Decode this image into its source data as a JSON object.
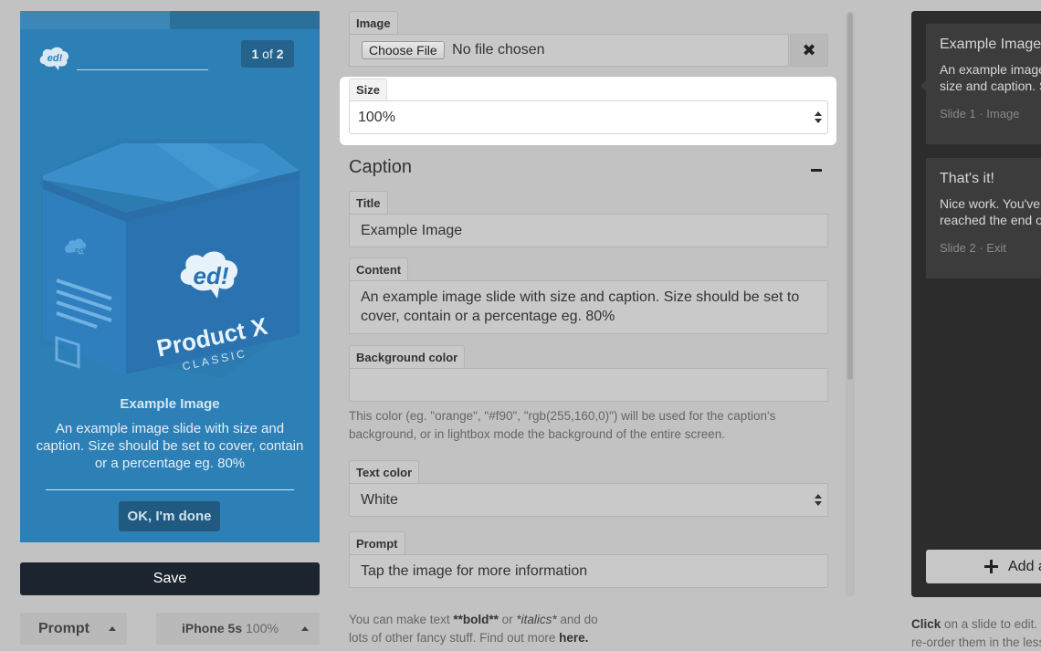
{
  "preview": {
    "progress_fraction": 0.5,
    "slide_current": "1",
    "slide_of": "of",
    "slide_total": "2",
    "logo_text": "ed!",
    "box_logo_text": "ed!",
    "box_product": "Product X",
    "box_edition": "CLASSIC",
    "title": "Example Image",
    "content": "An example image slide with size and caption. Size should be set to cover, contain or a percentage eg. 80%",
    "ok_label": "OK, I'm done"
  },
  "actions": {
    "save_label": "Save",
    "prompt_tab_label": "Prompt",
    "device_label": "iPhone 5s",
    "device_zoom": "100%"
  },
  "form": {
    "image_label": "Image",
    "choose_file_label": "Choose File",
    "file_status": "No file chosen",
    "clear_icon": "✖",
    "size_label": "Size",
    "size_value": "100%",
    "caption_heading": "Caption",
    "title_label": "Title",
    "title_value": "Example Image",
    "content_label": "Content",
    "content_value": "An example image slide with size and caption. Size should be set to cover, contain or a percentage eg. 80%",
    "bg_color_label": "Background color",
    "bg_color_value": "",
    "bg_color_help": "This color (eg. \"orange\", \"#f90\", \"rgb(255,160,0)\") will be used for the caption's background, or in lightbox mode the background of the entire screen.",
    "text_color_label": "Text color",
    "text_color_value": "White",
    "prompt_label": "Prompt",
    "prompt_value": "Tap the image for more information",
    "markdown_help": {
      "p1": "You can make text ",
      "bold": "**bold**",
      "p2": " or ",
      "italics": "*italics*",
      "p3": " and do lots of other fancy stuff. Find out more ",
      "link": "here."
    }
  },
  "slides": {
    "items": [
      {
        "title": "Example Image",
        "body": "An example image slide with size and caption. Size should be set to cover, contain or a percentage eg. 80%",
        "meta": "Slide 1 · Image"
      },
      {
        "title": "That's it!",
        "body": "Nice work. You've reached the end of the lesson.",
        "meta": "Slide 2 · Exit"
      }
    ],
    "add_label": "Add a slide",
    "help": {
      "click": "Click",
      "p1": " on a slide to edit. Drag to",
      "p2": "re-order them in the lesson."
    }
  }
}
